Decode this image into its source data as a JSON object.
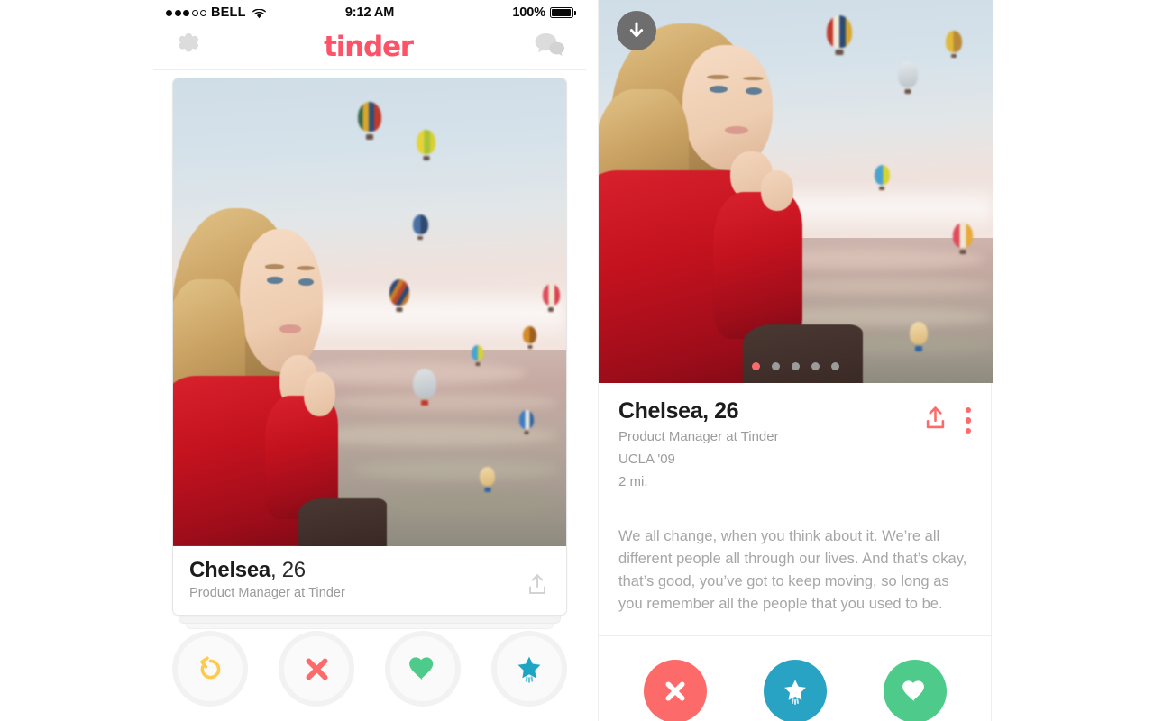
{
  "status_bar": {
    "signal_dots_filled": 3,
    "signal_dots_empty": 2,
    "carrier": "BELL",
    "wifi_icon": "wifi-icon",
    "time": "9:12 AM",
    "battery_percent": "100%",
    "battery_level": 100
  },
  "nav": {
    "settings_icon": "gear-icon",
    "logo_text": "tinder",
    "messages_icon": "chat-bubbles-icon",
    "brand_color": "#fe5268"
  },
  "card": {
    "photo_alt": "Woman in red shirt with hot air balloons",
    "name_bold": "Chelsea",
    "name_rest": ", 26",
    "subtitle": "Product Manager at Tinder",
    "share_icon": "share-upload-icon"
  },
  "left_actions": [
    {
      "name": "rewind-button",
      "icon": "rewind-arrow-icon",
      "color": "#ffc94d"
    },
    {
      "name": "nope-button",
      "icon": "x-cross-icon",
      "color": "#fd6a6a"
    },
    {
      "name": "like-button",
      "icon": "heart-icon",
      "color": "#4ecb8a"
    },
    {
      "name": "superlike-button",
      "icon": "star-icon",
      "color": "#1fa5c4"
    }
  ],
  "detail": {
    "download_icon": "download-arrow-icon",
    "photo_dots_total": 5,
    "photo_dots_active_index": 0,
    "active_dot_color": "#fd6a6a",
    "inactive_dot_color": "#9b9b9b",
    "name": "Chelsea, 26",
    "job": "Product Manager at Tinder",
    "school": "UCLA '09",
    "distance": "2 mi.",
    "share_icon": "share-upload-icon",
    "more_icon": "kebab-menu-icon",
    "icon_color": "#fd6a6a",
    "bio": "We all change, when you think about it. We’re all different people all through our lives. And that’s okay, that’s good, you’ve got to keep moving, so long as you remember all the people that you used to be."
  },
  "detail_actions": [
    {
      "name": "nope-button",
      "icon": "x-cross-icon",
      "color": "#fd6a6a"
    },
    {
      "name": "superlike-button",
      "icon": "star-icon",
      "color": "#29a3c4"
    },
    {
      "name": "like-button",
      "icon": "heart-icon",
      "color": "#4ecb8a"
    }
  ]
}
